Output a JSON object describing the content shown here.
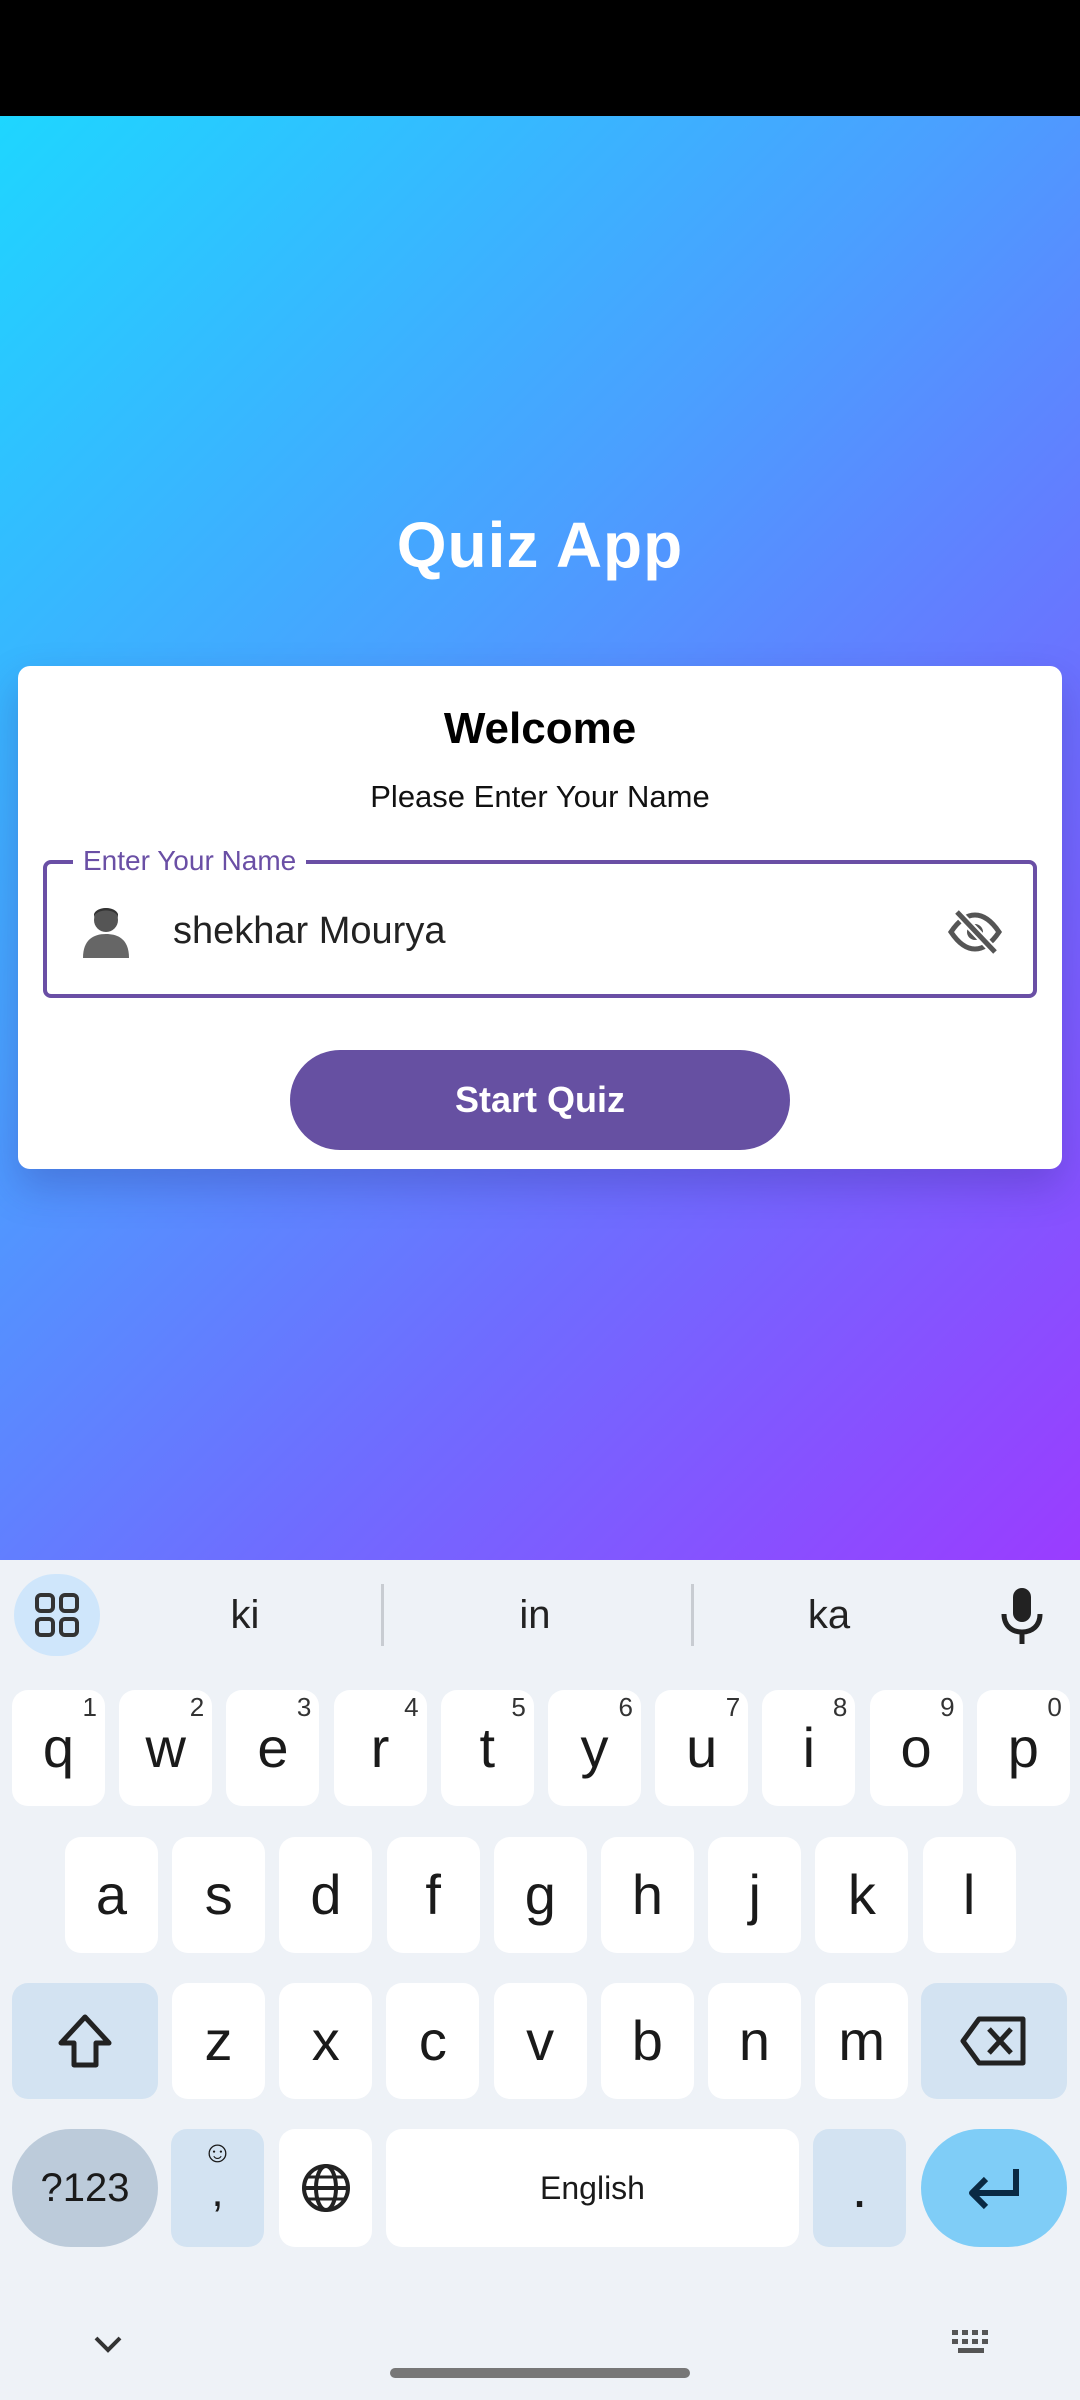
{
  "app": {
    "title": "Quiz App",
    "welcome": "Welcome",
    "subtitle": "Please Enter Your Name",
    "name_field": {
      "label": "Enter Your Name",
      "value": "shekhar Mourya"
    },
    "start_button": "Start Quiz"
  },
  "keyboard": {
    "suggestions": [
      "ki",
      "in",
      "ka"
    ],
    "row1": [
      {
        "k": "q",
        "h": "1"
      },
      {
        "k": "w",
        "h": "2"
      },
      {
        "k": "e",
        "h": "3"
      },
      {
        "k": "r",
        "h": "4"
      },
      {
        "k": "t",
        "h": "5"
      },
      {
        "k": "y",
        "h": "6"
      },
      {
        "k": "u",
        "h": "7"
      },
      {
        "k": "i",
        "h": "8"
      },
      {
        "k": "o",
        "h": "9"
      },
      {
        "k": "p",
        "h": "0"
      }
    ],
    "row2": [
      "a",
      "s",
      "d",
      "f",
      "g",
      "h",
      "j",
      "k",
      "l"
    ],
    "row3": [
      "z",
      "x",
      "c",
      "v",
      "b",
      "n",
      "m"
    ],
    "symbols_key": "?123",
    "emoji_comma_key": ",",
    "space_label": "English",
    "period_key": "."
  },
  "colors": {
    "accent": "#6650a2",
    "gradient_start": "#1ed6ff",
    "gradient_end": "#9a3cff",
    "enter_key": "#7fcdf7"
  },
  "icons": {
    "field_leading": "person-icon",
    "field_trailing": "eye-off-icon",
    "suggest_left": "apps-grid-icon",
    "suggest_right": "mic-icon",
    "shift": "shift-icon",
    "backspace": "backspace-icon",
    "globe": "globe-icon",
    "enter": "enter-icon",
    "hide_keyboard": "chevron-down-icon",
    "keyboard_switch": "keyboard-icon"
  }
}
